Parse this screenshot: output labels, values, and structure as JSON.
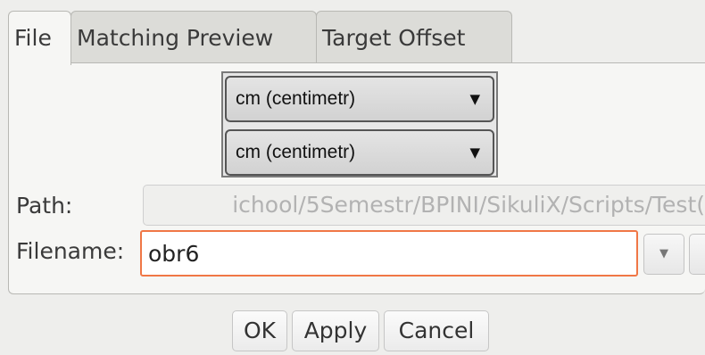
{
  "tabs": [
    {
      "label": "File",
      "active": true
    },
    {
      "label": "Matching Preview",
      "active": false
    },
    {
      "label": "Target Offset",
      "active": false
    }
  ],
  "units": {
    "first": "cm (centimetr)",
    "second": "cm (centimetr)",
    "arrow": "▼"
  },
  "path": {
    "label": "Path:",
    "value": "ichool/5Semestr/BPINI/SikuliX/Scripts/Test("
  },
  "filename": {
    "label": "Filename:",
    "value": "obr6",
    "dropdown_arrow": "▼"
  },
  "buttons": {
    "ok": "OK",
    "apply": "Apply",
    "cancel": "Cancel"
  },
  "colors": {
    "focus_border": "#f07746",
    "background": "#eeeeec"
  }
}
